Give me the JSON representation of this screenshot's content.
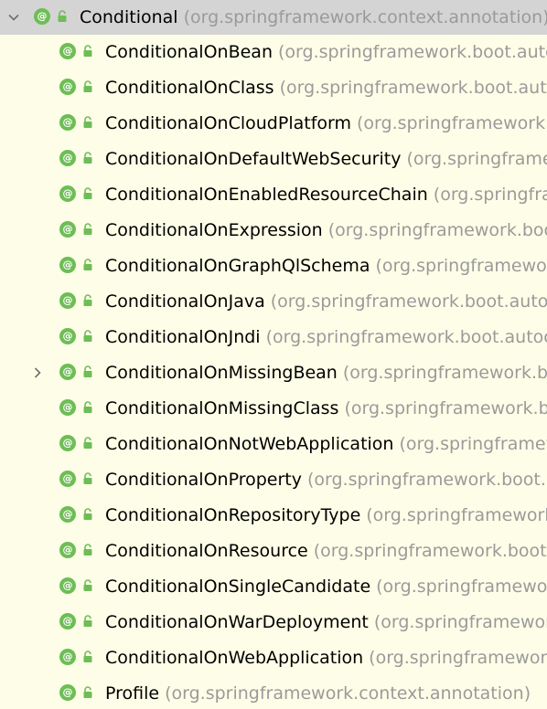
{
  "colors": {
    "background": "#fefee8",
    "root_row_background": "#d4d4d4",
    "annotation_icon": "#6ebd56",
    "lock_icon": "#6ebd56",
    "name_text": "#000000",
    "package_text": "#9a9a9a"
  },
  "tree": {
    "root": {
      "name": "Conditional",
      "package": "(org.springframework.context.annotation)",
      "expanded": true,
      "icon": "annotation-icon",
      "annotation_glyph": "@"
    },
    "children": [
      {
        "name": "ConditionalOnBean",
        "package": "(org.springframework.boot.autoconfigure.condition)",
        "has_children": false
      },
      {
        "name": "ConditionalOnClass",
        "package": "(org.springframework.boot.autoconfigure.condition)",
        "has_children": false
      },
      {
        "name": "ConditionalOnCloudPlatform",
        "package": "(org.springframework.boot.autoconfigure.condition)",
        "has_children": false
      },
      {
        "name": "ConditionalOnDefaultWebSecurity",
        "package": "(org.springframework.boot.autoconfigure.security)",
        "has_children": false
      },
      {
        "name": "ConditionalOnEnabledResourceChain",
        "package": "(org.springframework.boot.autoconfigure.web)",
        "has_children": false
      },
      {
        "name": "ConditionalOnExpression",
        "package": "(org.springframework.boot.autoconfigure.condition)",
        "has_children": false
      },
      {
        "name": "ConditionalOnGraphQlSchema",
        "package": "(org.springframework.boot.autoconfigure.graphql)",
        "has_children": false
      },
      {
        "name": "ConditionalOnJava",
        "package": "(org.springframework.boot.autoconfigure.condition)",
        "has_children": false
      },
      {
        "name": "ConditionalOnJndi",
        "package": "(org.springframework.boot.autoconfigure.condition)",
        "has_children": false
      },
      {
        "name": "ConditionalOnMissingBean",
        "package": "(org.springframework.boot.autoconfigure.condition)",
        "has_children": true
      },
      {
        "name": "ConditionalOnMissingClass",
        "package": "(org.springframework.boot.autoconfigure.condition)",
        "has_children": false
      },
      {
        "name": "ConditionalOnNotWebApplication",
        "package": "(org.springframework.boot.autoconfigure.condition)",
        "has_children": false
      },
      {
        "name": "ConditionalOnProperty",
        "package": "(org.springframework.boot.autoconfigure.condition)",
        "has_children": false
      },
      {
        "name": "ConditionalOnRepositoryType",
        "package": "(org.springframework.boot.autoconfigure.data)",
        "has_children": false
      },
      {
        "name": "ConditionalOnResource",
        "package": "(org.springframework.boot.autoconfigure.condition)",
        "has_children": false
      },
      {
        "name": "ConditionalOnSingleCandidate",
        "package": "(org.springframework.boot.autoconfigure.condition)",
        "has_children": false
      },
      {
        "name": "ConditionalOnWarDeployment",
        "package": "(org.springframework.boot.autoconfigure.condition)",
        "has_children": false
      },
      {
        "name": "ConditionalOnWebApplication",
        "package": "(org.springframework.boot.autoconfigure.condition)",
        "has_children": false
      },
      {
        "name": "Profile",
        "package": "(org.springframework.context.annotation)",
        "has_children": false
      }
    ]
  }
}
